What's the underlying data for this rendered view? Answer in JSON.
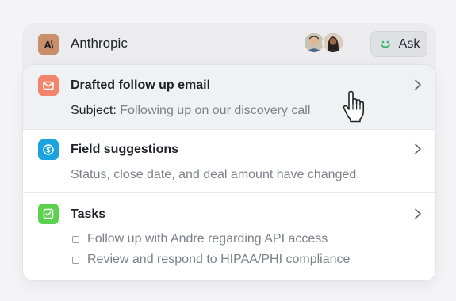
{
  "header": {
    "company_name": "Anthropic",
    "logo_text": "A\\",
    "ask_label": "Ask"
  },
  "items": [
    {
      "title": "Drafted follow up email",
      "subject_label": "Subject:",
      "subject_value": "Following up on our discovery call",
      "icon": "mail-icon",
      "color": "#f1846a"
    },
    {
      "title": "Field suggestions",
      "description": "Status, close date, and deal amount have changed.",
      "icon": "dollar-icon",
      "color": "#1aa3e0"
    },
    {
      "title": "Tasks",
      "icon": "checkbox-icon",
      "color": "#5cd14e",
      "tasks": [
        "Follow up with Andre regarding API access",
        "Review and respond to HIPAA/PHI compliance"
      ]
    }
  ]
}
